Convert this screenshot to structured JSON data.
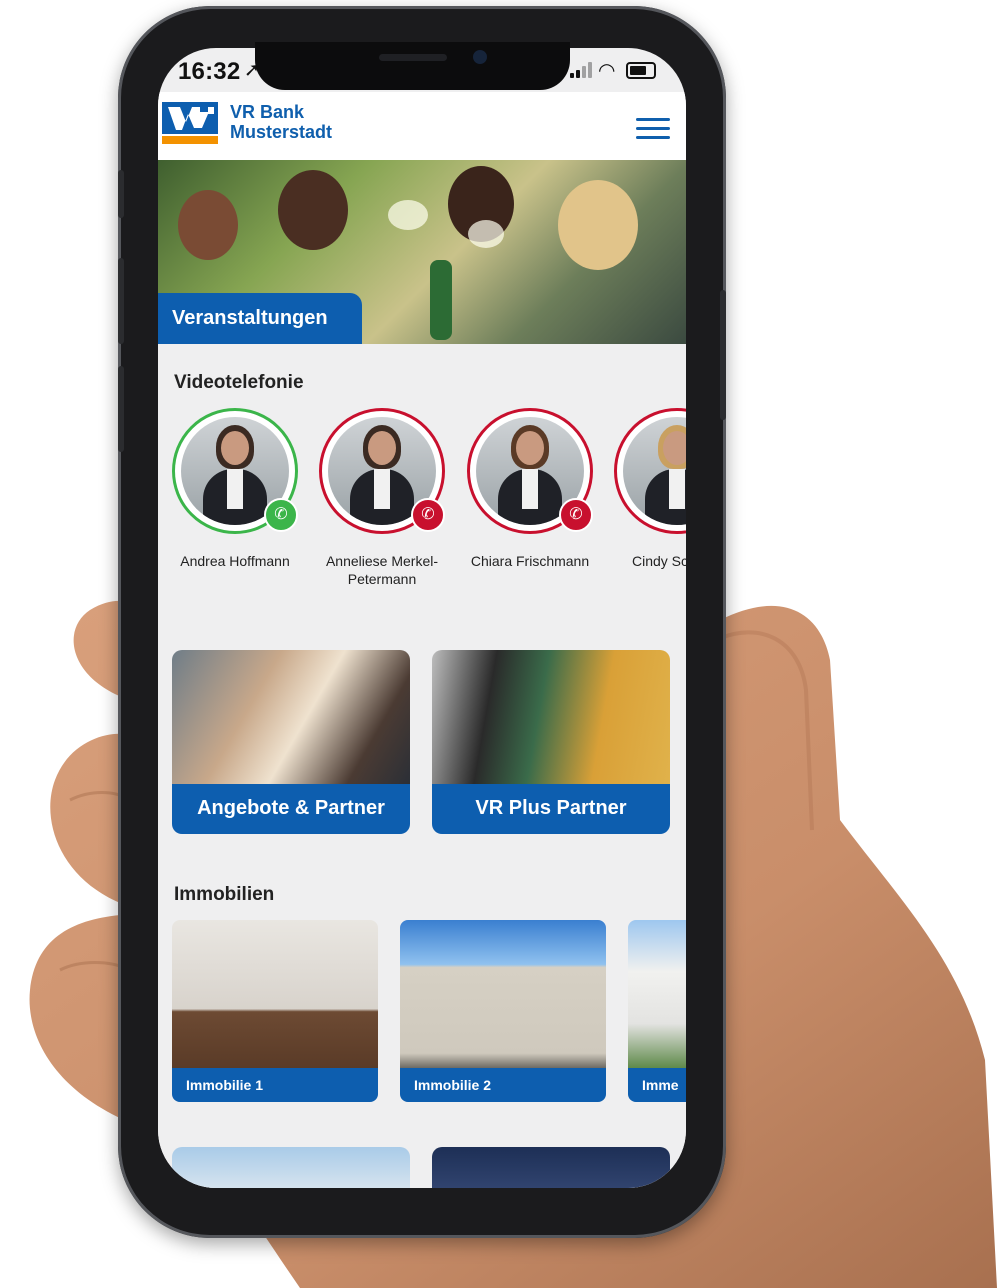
{
  "status_bar": {
    "time": "16:32",
    "location_icon": "location-arrow-icon",
    "signal_icon": "cellular-signal-icon",
    "wifi_icon": "wifi-icon",
    "battery_icon": "battery-icon"
  },
  "header": {
    "bank_name_line1": "VR Bank",
    "bank_name_line2": "Musterstadt",
    "menu_icon": "hamburger-menu-icon"
  },
  "hero": {
    "label": "Veranstaltungen"
  },
  "video_section": {
    "title": "Videotelefonie",
    "contacts": [
      {
        "name": "Andrea Hoffmann",
        "status": "available",
        "ring_color": "#3bb54a"
      },
      {
        "name": "Anneliese Merkel-Petermann",
        "status": "busy",
        "ring_color": "#c8102e"
      },
      {
        "name": "Chiara Frischmann",
        "status": "busy",
        "ring_color": "#c8102e"
      },
      {
        "name": "Cindy Sc",
        "status": "busy",
        "ring_color": "#c8102e"
      }
    ]
  },
  "cards": [
    {
      "label": "Angebote & Partner"
    },
    {
      "label": "VR Plus Partner"
    }
  ],
  "real_estate": {
    "title": "Immobilien",
    "items": [
      {
        "label": "Immobilie 1"
      },
      {
        "label": "Immobilie 2"
      },
      {
        "label": "Imme"
      }
    ]
  },
  "colors": {
    "brand_blue": "#0d5eaf",
    "brand_orange": "#f39200",
    "available_green": "#3bb54a",
    "busy_red": "#c8102e"
  }
}
